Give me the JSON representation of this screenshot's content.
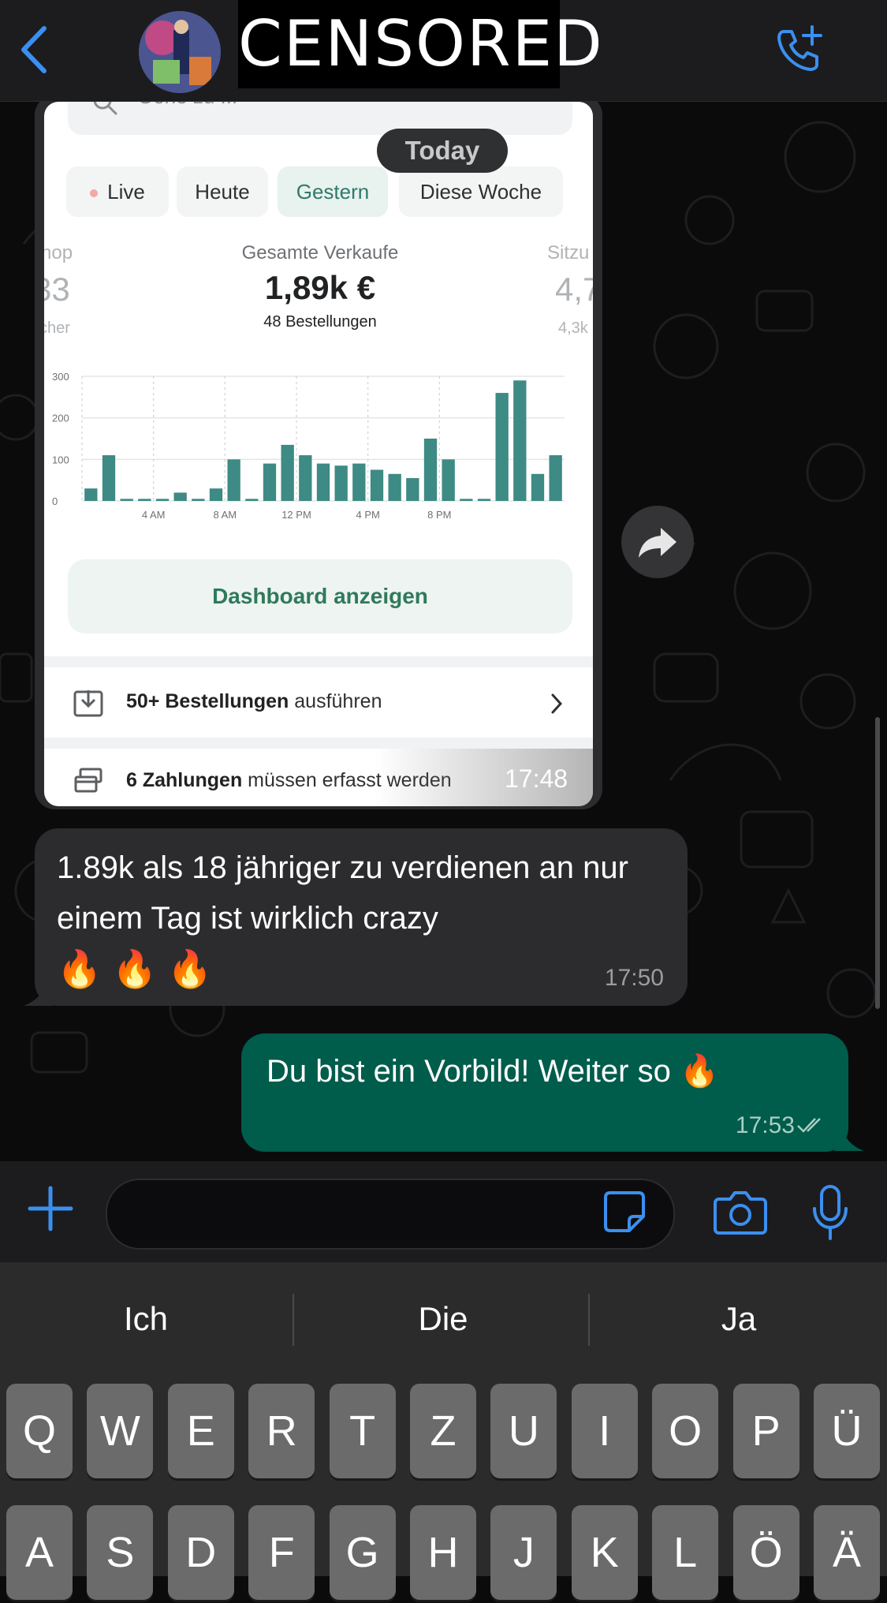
{
  "header": {
    "censor_text": "CENSORED"
  },
  "chat": {
    "date_chip": "Today",
    "screenshot": {
      "search_placeholder": "Gehe zu ...",
      "tabs": [
        {
          "label": "Live"
        },
        {
          "label": "Heute"
        },
        {
          "label": "Gestern"
        },
        {
          "label": "Diese Woche"
        }
      ],
      "metric_left": {
        "label": "hop",
        "value": "33",
        "sub": "cher"
      },
      "metric_main": {
        "label": "Gesamte Verkaufe",
        "value": "1,89k €",
        "sub": "48 Bestellungen"
      },
      "metric_right": {
        "label": "Sitzu",
        "value": "4,7",
        "sub": "4,3k"
      },
      "dashboard_button": "Dashboard anzeigen",
      "row1": {
        "bold": "50+ Bestellungen",
        "rest": " ausführen"
      },
      "row2": {
        "bold": "6 Zahlungen",
        "rest": " müssen erfasst werden"
      },
      "time": "17:48"
    },
    "incoming": {
      "text": "1.89k als 18 jähriger zu verdienen an nur einem Tag ist wirklich crazy",
      "emoji": "🔥 🔥 🔥",
      "time": "17:50"
    },
    "outgoing": {
      "text": "Du bist ein Vorbild! Weiter so 🔥",
      "time": "17:53"
    }
  },
  "chart_data": {
    "type": "bar",
    "title": "",
    "xlabel": "",
    "ylabel": "",
    "ylim": [
      0,
      300
    ],
    "y_ticks": [
      "0",
      "100",
      "200",
      "300"
    ],
    "x_tick_labels": [
      {
        "index": 4,
        "label": "4 AM"
      },
      {
        "index": 8,
        "label": "8 AM"
      },
      {
        "index": 12,
        "label": "12 PM"
      },
      {
        "index": 16,
        "label": "4 PM"
      },
      {
        "index": 20,
        "label": "8 PM"
      }
    ],
    "values": [
      30,
      110,
      5,
      5,
      5,
      20,
      5,
      30,
      100,
      5,
      90,
      135,
      110,
      90,
      85,
      90,
      75,
      65,
      55,
      150,
      100,
      5,
      5,
      260,
      290,
      65,
      110
    ],
    "color": "#3e8a84",
    "grid": true
  },
  "keyboard": {
    "suggestions": [
      "Ich",
      "Die",
      "Ja"
    ],
    "row1": [
      "Q",
      "W",
      "E",
      "R",
      "T",
      "Z",
      "U",
      "I",
      "O",
      "P",
      "Ü"
    ],
    "row2": [
      "A",
      "S",
      "D",
      "F",
      "G",
      "H",
      "J",
      "K",
      "L",
      "Ö",
      "Ä"
    ]
  },
  "colors": {
    "accent": "#4a9df0",
    "outgoing_bubble": "#005c4b",
    "incoming_bubble": "#2c2c2e"
  }
}
